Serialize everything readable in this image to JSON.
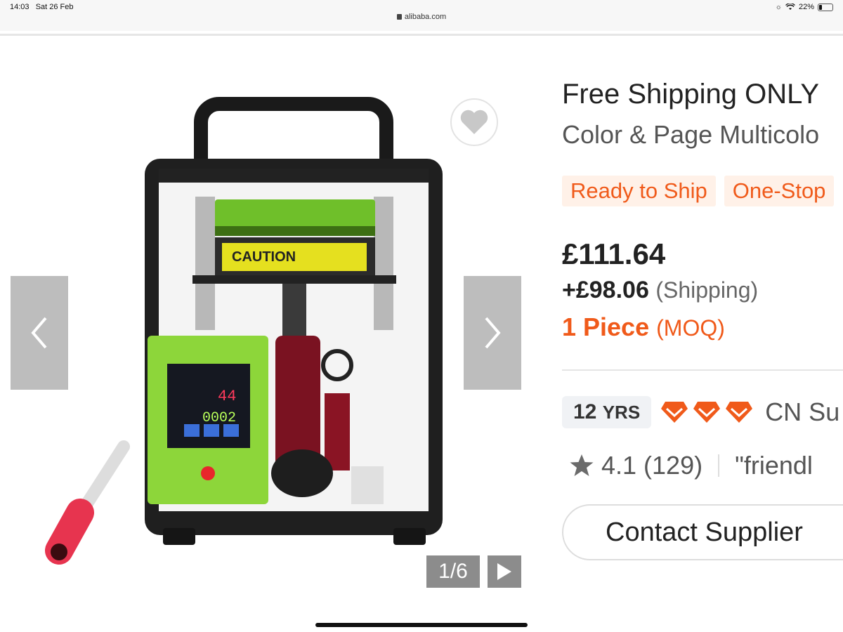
{
  "status_bar": {
    "time": "14:03",
    "date": "Sat 26 Feb",
    "url": "alibaba.com",
    "battery": "22%",
    "battery_level": 0.22
  },
  "gallery": {
    "counter": "1/6",
    "prev_icon": "chevron-left-icon",
    "next_icon": "chevron-right-icon",
    "favorite_icon": "heart-icon",
    "play_icon": "play-icon",
    "product_caution_label": "CAUTION",
    "product_display_timer": "0002",
    "product_display_temp": "44"
  },
  "product": {
    "title": "Free Shipping ONLY",
    "subtitle": "Color & Page Multicolo",
    "tags": [
      "Ready to Ship",
      "One-Stop"
    ],
    "price": "£111.64",
    "shipping_price": "+£98.06",
    "shipping_label": "(Shipping)",
    "moq_value": "1 Piece",
    "moq_label": "(MOQ)"
  },
  "supplier": {
    "years_number": "12",
    "years_unit": "YRS",
    "country": "CN Su",
    "rating": "4.1",
    "review_count": "(129)",
    "review_quote": "\"friendl",
    "contact_label": "Contact Supplier"
  },
  "colors": {
    "accent": "#f05a1a",
    "tag_bg": "#fff1e8",
    "arrow_bg": "#bdbdbd",
    "counter_bg": "#8c8c8c"
  }
}
